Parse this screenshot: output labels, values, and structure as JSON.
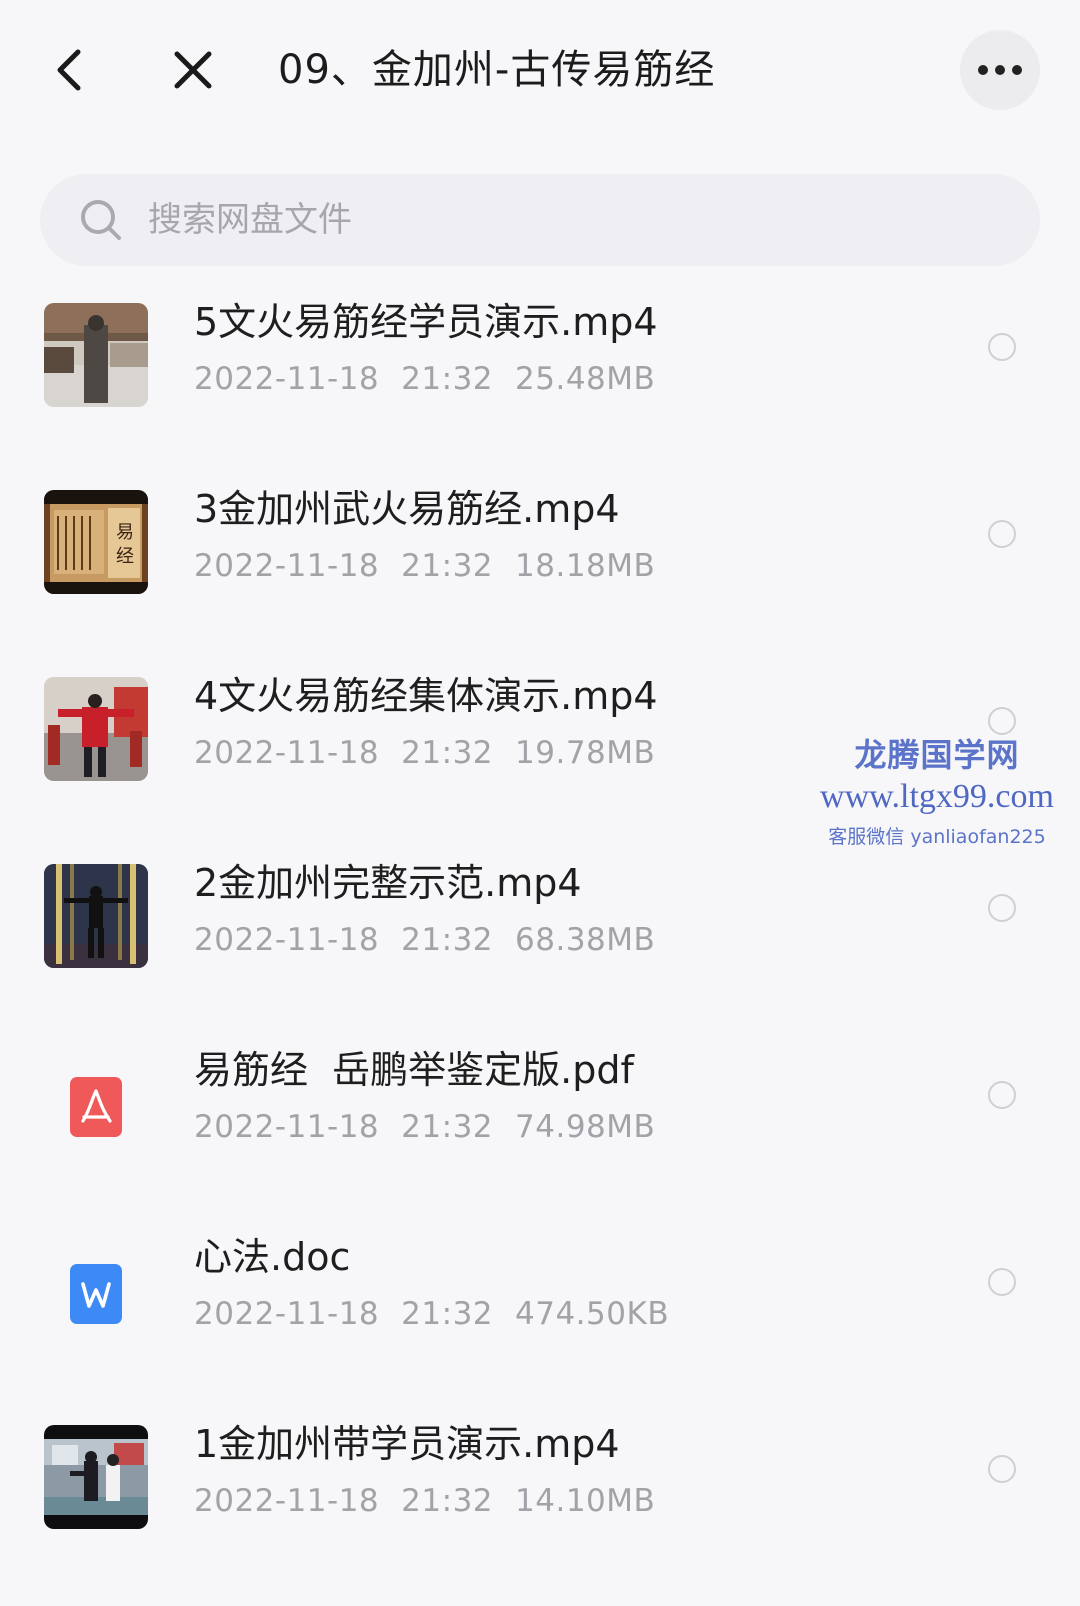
{
  "header": {
    "title": "09、金加州-古传易筋经"
  },
  "search": {
    "placeholder": "搜索网盘文件"
  },
  "files": [
    {
      "name": "5文火易筋经学员演示.mp4",
      "date": "2022-11-18",
      "time": "21:32",
      "size": "25.48MB",
      "type": "video",
      "thumb": "video-still-courtyard"
    },
    {
      "name": "3金加州武火易筋经.mp4",
      "date": "2022-11-18",
      "time": "21:32",
      "size": "18.18MB",
      "type": "video",
      "thumb": "video-still-ancient-book"
    },
    {
      "name": "4文火易筋经集体演示.mp4",
      "date": "2022-11-18",
      "time": "21:32",
      "size": "19.78MB",
      "type": "video",
      "thumb": "video-still-group-red"
    },
    {
      "name": "2金加州完整示范.mp4",
      "date": "2022-11-18",
      "time": "21:32",
      "size": "68.38MB",
      "type": "video",
      "thumb": "video-still-stage"
    },
    {
      "name": "易筋经  岳鹏举鉴定版.pdf",
      "date": "2022-11-18",
      "time": "21:32",
      "size": "74.98MB",
      "type": "pdf",
      "thumb": "pdf-icon"
    },
    {
      "name": "心法.doc",
      "date": "2022-11-18",
      "time": "21:32",
      "size": "474.50KB",
      "type": "doc",
      "thumb": "word-icon"
    },
    {
      "name": "1金加州带学员演示.mp4",
      "date": "2022-11-18",
      "time": "21:32",
      "size": "14.10MB",
      "type": "video",
      "thumb": "video-still-hall"
    }
  ],
  "watermark": {
    "title": "龙腾国学网",
    "url": "www.ltgx99.com",
    "contact": "客服微信 yanliaofan225"
  },
  "colors": {
    "background": "#f7f7f9",
    "pdf_red": "#f0595a",
    "word_blue": "#3d8af7",
    "watermark_blue": "#5b74c9"
  }
}
